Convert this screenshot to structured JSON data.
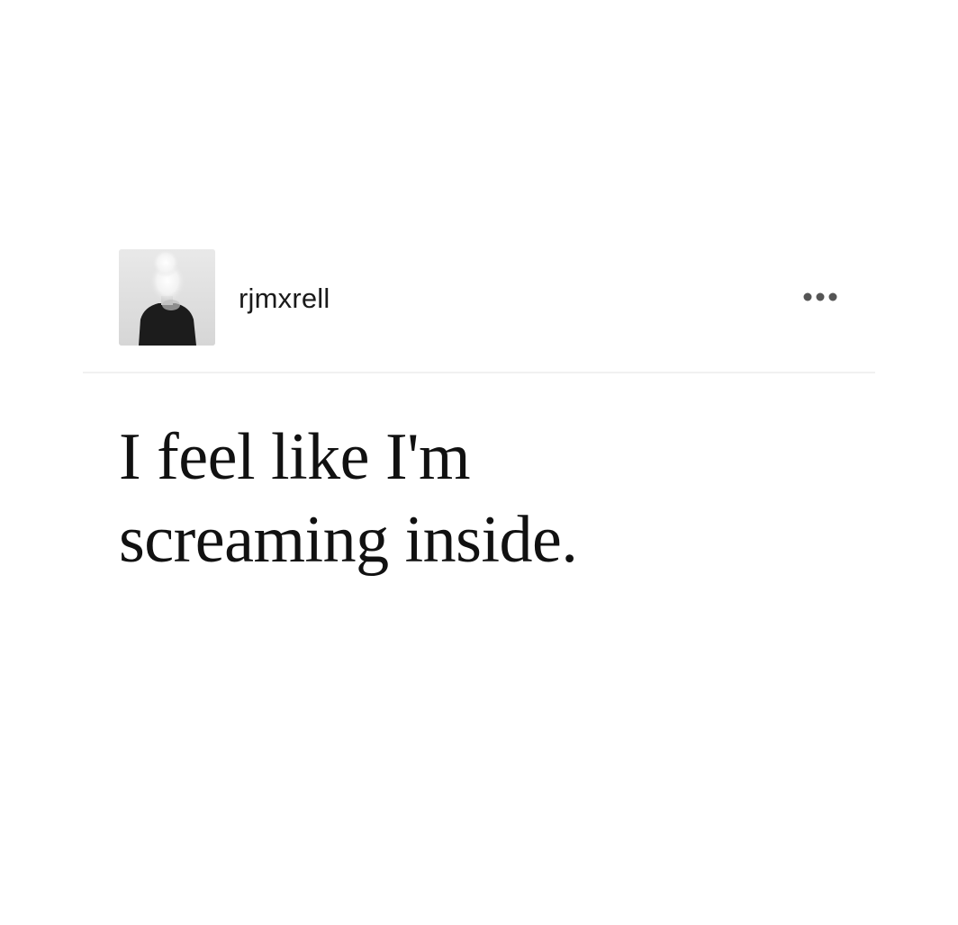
{
  "post": {
    "username": "rjmxrell",
    "avatar_icon": "person-smoke-avatar",
    "menu_icon": "more-horizontal-icon",
    "text_line_1": "I feel like I'm",
    "text_line_2": "screaming inside."
  },
  "colors": {
    "background": "#ffffff",
    "text": "#111111",
    "divider": "#f1f1f1",
    "icon": "#555555"
  }
}
